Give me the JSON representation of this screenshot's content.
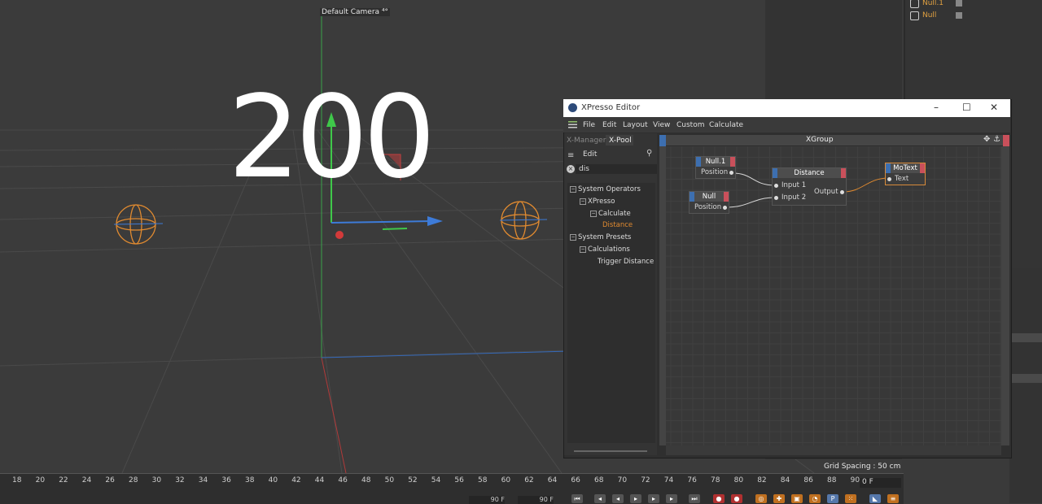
{
  "viewport": {
    "camera_label": "Default Camera",
    "camera_marker": "⁴°",
    "big_text": "200",
    "grid_spacing": "Grid Spacing : 50 cm"
  },
  "object_manager": {
    "items": [
      {
        "label": "Null.1"
      },
      {
        "label": "Null"
      }
    ]
  },
  "timeline": {
    "ticks": [
      "18",
      "20",
      "22",
      "24",
      "26",
      "28",
      "30",
      "32",
      "34",
      "36",
      "38",
      "40",
      "42",
      "44",
      "46",
      "48",
      "50",
      "52",
      "54",
      "56",
      "58",
      "60",
      "62",
      "64",
      "66",
      "68",
      "70",
      "72",
      "74",
      "76",
      "78",
      "80",
      "82",
      "84",
      "86",
      "88",
      "90"
    ],
    "current_frame": "0 F",
    "field_a": "90 F",
    "field_b": "90 F"
  },
  "xpresso": {
    "title": "XPresso Editor",
    "menu": [
      "File",
      "Edit",
      "Layout",
      "View",
      "Custom",
      "Calculate"
    ],
    "pool_tabs": [
      "X-Manager",
      "X-Pool"
    ],
    "pool_edit": "Edit",
    "search_value": "dis",
    "tree": [
      {
        "label": "System Operators",
        "box": "−"
      },
      {
        "label": "XPresso",
        "box": "−"
      },
      {
        "label": "Calculate",
        "box": "−"
      },
      {
        "label": "Distance",
        "box": ""
      },
      {
        "label": "System Presets",
        "box": "−"
      },
      {
        "label": "Calculations",
        "box": "−"
      },
      {
        "label": "Trigger Distance",
        "box": ""
      }
    ],
    "group_title": "XGroup",
    "nodes": {
      "null1": {
        "title": "Null.1",
        "port": "Position"
      },
      "null": {
        "title": "Null",
        "port": "Position"
      },
      "distance": {
        "title": "Distance",
        "in1": "Input 1",
        "in2": "Input 2",
        "out": "Output"
      },
      "motext": {
        "title": "MoText",
        "port": "Text"
      }
    }
  },
  "colors": {
    "accent_orange": "#e08a30",
    "axis_blue": "#3d7bd8",
    "axis_green": "#3fc84a",
    "axis_red": "#d23a3a"
  }
}
